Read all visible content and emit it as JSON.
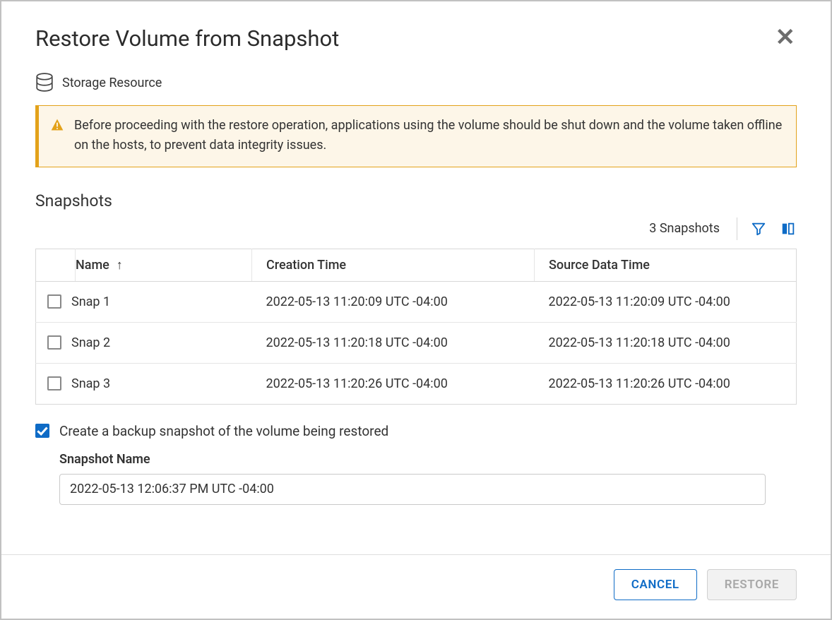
{
  "dialog": {
    "title": "Restore Volume from Snapshot",
    "resource_label": "Storage Resource"
  },
  "alert": {
    "text": "Before proceeding with the restore operation, applications using the volume should be shut down and the volume taken offline on the hosts, to prevent data integrity issues."
  },
  "snapshots": {
    "section_title": "Snapshots",
    "count_text": "3 Snapshots",
    "columns": {
      "name": "Name",
      "creation": "Creation Time",
      "source": "Source Data Time"
    },
    "rows": [
      {
        "name": "Snap 1",
        "creation": "2022-05-13 11:20:09 UTC -04:00",
        "source": "2022-05-13 11:20:09 UTC -04:00"
      },
      {
        "name": "Snap 2",
        "creation": "2022-05-13 11:20:18 UTC -04:00",
        "source": "2022-05-13 11:20:18 UTC -04:00"
      },
      {
        "name": "Snap 3",
        "creation": "2022-05-13 11:20:26 UTC -04:00",
        "source": "2022-05-13 11:20:26 UTC -04:00"
      }
    ]
  },
  "backup": {
    "checkbox_label": "Create a backup snapshot of the volume being restored",
    "checked": true,
    "name_label": "Snapshot Name",
    "name_value": "2022-05-13 12:06:37 PM UTC -04:00"
  },
  "footer": {
    "cancel": "CANCEL",
    "restore": "RESTORE"
  }
}
